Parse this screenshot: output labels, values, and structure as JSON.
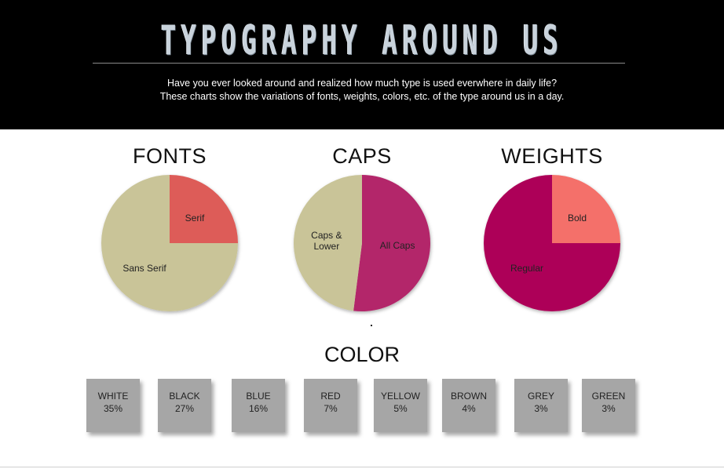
{
  "header": {
    "title": "TYPOGRAPHY AROUND US",
    "subtitle_line1": "Have you ever looked around and realized how much type is used everwhere in daily life?",
    "subtitle_line2": "These charts show the variations of fonts, weights, colors, etc. of the type around us in a day."
  },
  "chart_data": [
    {
      "type": "pie",
      "title": "FONTS",
      "slices": [
        {
          "label": "Serif",
          "value": 25,
          "color": "#dd5c59"
        },
        {
          "label": "Sans Serif",
          "value": 75,
          "color": "#c9c498"
        }
      ]
    },
    {
      "type": "pie",
      "title": "CAPS",
      "slices": [
        {
          "label": "All Caps",
          "value": 52,
          "color": "#b3266a"
        },
        {
          "label": "Caps & Lower",
          "value": 48,
          "color": "#c9c498"
        }
      ]
    },
    {
      "type": "pie",
      "title": "WEIGHTS",
      "slices": [
        {
          "label": "Bold",
          "value": 25,
          "color": "#f4706b"
        },
        {
          "label": "Regular",
          "value": 75,
          "color": "#ad0658"
        }
      ]
    }
  ],
  "color_section": {
    "title": "COLOR",
    "swatches": [
      {
        "name": "WHITE",
        "percent": "35%"
      },
      {
        "name": "BLACK",
        "percent": "27%"
      },
      {
        "name": "BLUE",
        "percent": "16%"
      },
      {
        "name": "RED",
        "percent": "7%"
      },
      {
        "name": "YELLOW",
        "percent": "5%"
      },
      {
        "name": "BROWN",
        "percent": "4%"
      },
      {
        "name": "GREY",
        "percent": "3%"
      },
      {
        "name": "GREEN",
        "percent": "3%"
      }
    ]
  }
}
